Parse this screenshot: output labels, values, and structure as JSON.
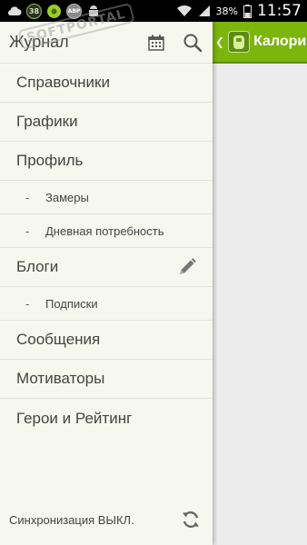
{
  "statusbar": {
    "badge_38": "38",
    "badge_abp": "ABP",
    "battery_percent": "38%",
    "time": "11:57"
  },
  "main": {
    "title": "Калори"
  },
  "drawer": {
    "header_title": "Журнал",
    "items": [
      {
        "label": "Справочники"
      },
      {
        "label": "Графики"
      },
      {
        "label": "Профиль"
      },
      {
        "label": "Замеры",
        "sub": true
      },
      {
        "label": "Дневная потребность",
        "sub": true
      },
      {
        "label": "Блоги"
      },
      {
        "label": "Подписки",
        "sub": true
      },
      {
        "label": "Сообщения"
      },
      {
        "label": "Мотиваторы"
      },
      {
        "label": "Герои и Рейтинг"
      }
    ],
    "dash": "-",
    "footer_sync": "Синхронизация ВЫКЛ."
  },
  "watermark": "SOFTPORTAL",
  "colors": {
    "accent": "#7cb50c",
    "drawer_bg": "#f6f7ee"
  }
}
